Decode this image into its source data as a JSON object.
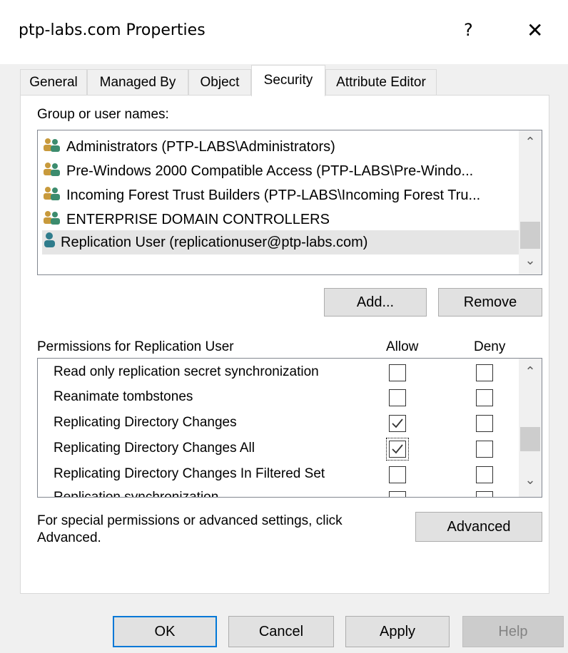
{
  "window": {
    "title": "ptp-labs.com Properties",
    "help_glyph": "?",
    "close_glyph": "✕"
  },
  "tabs": [
    {
      "label": "General",
      "active": false
    },
    {
      "label": "Managed By",
      "active": false
    },
    {
      "label": "Object",
      "active": false
    },
    {
      "label": "Security",
      "active": true
    },
    {
      "label": "Attribute Editor",
      "active": false
    }
  ],
  "security": {
    "group_label": "Group or user names:",
    "principals": [
      {
        "label": "Administrators (PTP-LABS\\Administrators)",
        "icon": "group-icon",
        "selected": false
      },
      {
        "label": "Pre-Windows 2000 Compatible Access (PTP-LABS\\Pre-Windo...",
        "icon": "group-icon",
        "selected": false
      },
      {
        "label": "Incoming Forest Trust Builders (PTP-LABS\\Incoming Forest Tru...",
        "icon": "group-icon",
        "selected": false
      },
      {
        "label": "ENTERPRISE DOMAIN CONTROLLERS",
        "icon": "group-icon",
        "selected": false
      },
      {
        "label": "Replication User (replicationuser@ptp-labs.com)",
        "icon": "user-icon",
        "selected": true
      }
    ],
    "add_label": "Add...",
    "remove_label": "Remove",
    "permissions_label": "Permissions for Replication User",
    "allow_label": "Allow",
    "deny_label": "Deny",
    "permissions": [
      {
        "name": "Read only replication secret synchronization",
        "allow": false,
        "deny": false
      },
      {
        "name": "Reanimate tombstones",
        "allow": false,
        "deny": false
      },
      {
        "name": "Replicating Directory Changes",
        "allow": true,
        "deny": false
      },
      {
        "name": "Replicating Directory Changes All",
        "allow": true,
        "deny": false,
        "focused": true
      },
      {
        "name": "Replicating Directory Changes In Filtered Set",
        "allow": false,
        "deny": false
      },
      {
        "name": "Replication synchronization",
        "allow": false,
        "deny": false,
        "clipped": true
      }
    ],
    "advanced_text_line1": "For special permissions or advanced settings, click",
    "advanced_text_line2": "Advanced.",
    "advanced_label": "Advanced"
  },
  "footer": {
    "ok_label": "OK",
    "cancel_label": "Cancel",
    "apply_label": "Apply",
    "help_label": "Help"
  },
  "colors": {
    "accent": "#0078d7",
    "group_icon_primary": "#c89a3c",
    "group_icon_secondary": "#3c8c6e",
    "user_icon": "#2f7c8c"
  }
}
